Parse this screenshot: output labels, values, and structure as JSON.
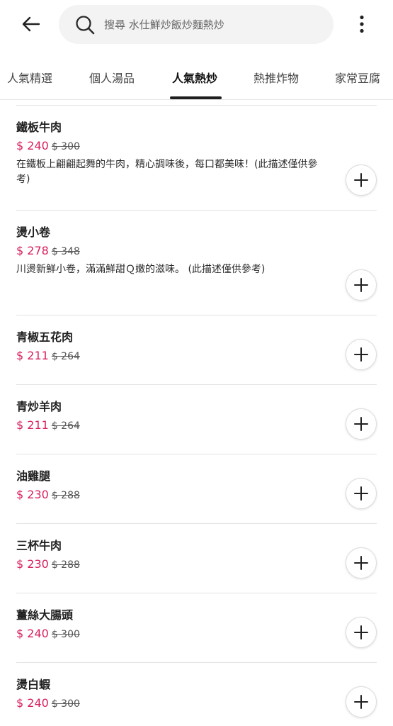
{
  "header": {
    "search_placeholder": "搜尋 水仕鮮炒飯炒麵熱炒"
  },
  "tabs": [
    {
      "label": "人氣精選"
    },
    {
      "label": "個人湯品"
    },
    {
      "label": "人氣熱炒",
      "active": true
    },
    {
      "label": "熱推炸物"
    },
    {
      "label": "家常豆腐"
    }
  ],
  "items": [
    {
      "name": "鐵板牛肉",
      "price": "$ 240",
      "original_price": "$ 300",
      "description": "在鐵板上翩翩起舞的牛肉，精心調味後，每口都美味！(此描述僅供參考)"
    },
    {
      "name": "燙小卷",
      "price": "$ 278",
      "original_price": "$ 348",
      "description": "川燙新鮮小卷，滿滿鮮甜Ｑ嫩的滋味。 (此描述僅供參考)"
    },
    {
      "name": "青椒五花肉",
      "price": "$ 211",
      "original_price": "$ 264"
    },
    {
      "name": "青炒羊肉",
      "price": "$ 211",
      "original_price": "$ 264"
    },
    {
      "name": "油雞腿",
      "price": "$ 230",
      "original_price": "$ 288"
    },
    {
      "name": "三杯牛肉",
      "price": "$ 230",
      "original_price": "$ 288"
    },
    {
      "name": "薑絲大腸頭",
      "price": "$ 240",
      "original_price": "$ 300"
    },
    {
      "name": "燙白蝦",
      "price": "$ 240",
      "original_price": "$ 300"
    }
  ],
  "colors": {
    "price": "#d7205c",
    "active_tab_underline": "#1f1f1f",
    "search_bg": "#f3f3f3"
  },
  "icons": [
    "back-arrow-icon",
    "search-icon",
    "more-vertical-icon",
    "plus-icon"
  ]
}
